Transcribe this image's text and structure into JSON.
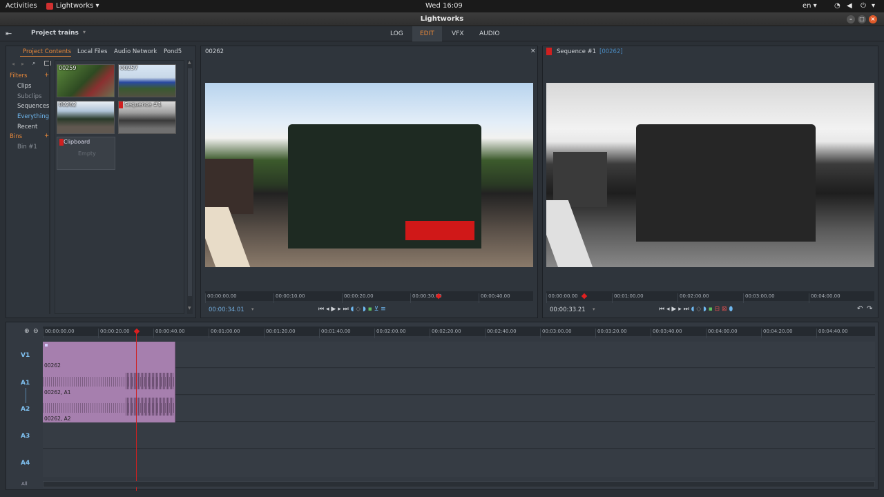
{
  "system_bar": {
    "activities": "Activities",
    "app_menu": "Lightworks",
    "clock": "Wed 16:09",
    "language": "en"
  },
  "window": {
    "title": "Lightworks"
  },
  "app_bar": {
    "project": "Project trains",
    "tabs": [
      {
        "label": "LOG",
        "active": false
      },
      {
        "label": "EDIT",
        "active": true
      },
      {
        "label": "VFX",
        "active": false
      },
      {
        "label": "AUDIO",
        "active": false
      }
    ]
  },
  "browser": {
    "tabs": [
      {
        "label": "Project Contents",
        "active": true
      },
      {
        "label": "Local Files",
        "active": false
      },
      {
        "label": "Audio Network",
        "active": false
      },
      {
        "label": "Pond5",
        "active": false
      }
    ],
    "filters_label": "Filters",
    "filters": [
      "Clips",
      "Subclips",
      "Sequences",
      "Everything",
      "Recent"
    ],
    "active_filter": "Everything",
    "bins_label": "Bins",
    "bins": [
      "Bin #1"
    ],
    "thumbnails": [
      {
        "label": "00259"
      },
      {
        "label": "00257"
      },
      {
        "label": "00262"
      },
      {
        "label": "Sequence #1"
      }
    ],
    "clipboard": {
      "label": "Clipboard",
      "empty_text": "Empty"
    }
  },
  "source_viewer": {
    "title": "00262",
    "ruler": [
      "00:00:00.00",
      "00:00:10.00",
      "00:00:20.00",
      "00:00:30.00",
      "00:00:40.00"
    ],
    "timecode": "00:00:34.01"
  },
  "record_viewer": {
    "title": "Sequence #1",
    "subtitle": "[00262]",
    "ruler": [
      "00:00:00.00",
      "00:01:00.00",
      "00:02:00.00",
      "00:03:00.00",
      "00:04:00.00"
    ],
    "timecode": "00:00:33.21"
  },
  "timeline": {
    "ruler": [
      "00:00:00.00",
      "00:00:20.00",
      "00:00:40.00",
      "00:01:00.00",
      "00:01:20.00",
      "00:01:40.00",
      "00:02:00.00",
      "00:02:20.00",
      "00:02:40.00",
      "00:03:00.00",
      "00:03:20.00",
      "00:03:40.00",
      "00:04:00.00",
      "00:04:20.00",
      "00:04:40.00"
    ],
    "tracks": [
      "V1",
      "A1",
      "A2",
      "A3",
      "A4"
    ],
    "clips": [
      {
        "track": "V1",
        "label": "00262"
      },
      {
        "track": "A1",
        "label": "00262, A1"
      },
      {
        "track": "A2",
        "label": "00262, A2"
      }
    ],
    "all_label": "All"
  },
  "colors": {
    "accent": "#e8883a",
    "track_label": "#7fc0f0",
    "clip": "#a67fae",
    "playhead": "#e02020"
  }
}
